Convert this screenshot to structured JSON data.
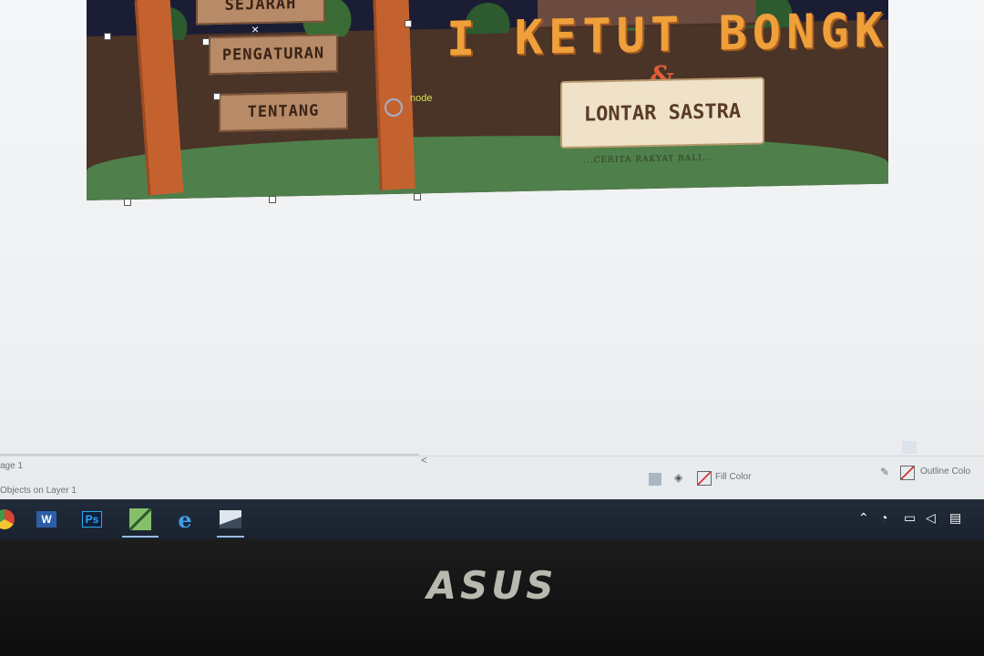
{
  "artwork": {
    "menu_signs": [
      "SEJARAH",
      "PENGATURAN",
      "TENTANG"
    ],
    "title": "I KETUT BONGKLING",
    "ampersand": "&",
    "scroll_text": "LONTAR SASTRA",
    "subtitle": "...CERITA RAKYAT BALI..."
  },
  "canvas": {
    "node_label": "node",
    "x_marker": "×"
  },
  "status_bar": {
    "page_tab": "age 1",
    "objects_text": "Objects on Layer 1",
    "fill_label": "Fill Color",
    "outline_label": "Outline Colo",
    "scroll_left_arrow": "<"
  },
  "taskbar": {
    "apps": [
      {
        "name": "chrome-icon",
        "label": ""
      },
      {
        "name": "word-icon",
        "label": "W"
      },
      {
        "name": "photoshop-icon",
        "label": "Ps"
      },
      {
        "name": "coreldraw-icon",
        "label": ""
      },
      {
        "name": "edge-icon",
        "label": "e"
      },
      {
        "name": "photos-icon",
        "label": ""
      }
    ],
    "tray_icons": [
      "chevron-up-icon",
      "wifi-icon",
      "battery-icon",
      "volume-icon",
      "notification-icon"
    ]
  },
  "device": {
    "brand": "ASUS"
  },
  "colors": {
    "sign_wood": "#b78a68",
    "title_orange": "#f0a03a",
    "grass": "#4f7f4a",
    "taskbar": "#1a2230"
  }
}
